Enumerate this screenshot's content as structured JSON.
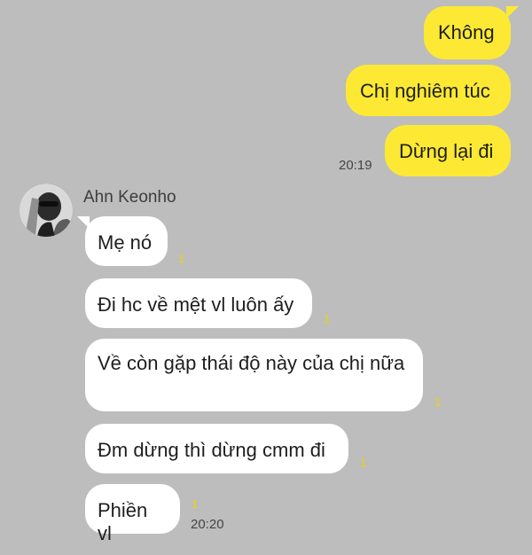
{
  "outgoing": [
    {
      "text": "Không"
    },
    {
      "text": "Chị nghiêm túc"
    },
    {
      "text": "Dừng lại đi",
      "time": "20:19"
    }
  ],
  "sender": {
    "name": "Ahn Keonho",
    "avatar_icon": "profile-photo"
  },
  "incoming": [
    {
      "text": "Mẹ nó",
      "unread": "1"
    },
    {
      "text": "Đi hc về mệt vl luôn ấy",
      "unread": "1"
    },
    {
      "text": "Về còn gặp thái độ này của chị nữa",
      "unread": "1"
    },
    {
      "text": "Đm dừng thì dừng cmm đi",
      "unread": "1"
    },
    {
      "text": "Phiền vl",
      "unread": "1",
      "time": "20:20"
    }
  ],
  "colors": {
    "background": "#bdbdbd",
    "outgoing_bubble": "#fde933",
    "incoming_bubble": "#ffffff",
    "unread_count": "#f2d200"
  }
}
